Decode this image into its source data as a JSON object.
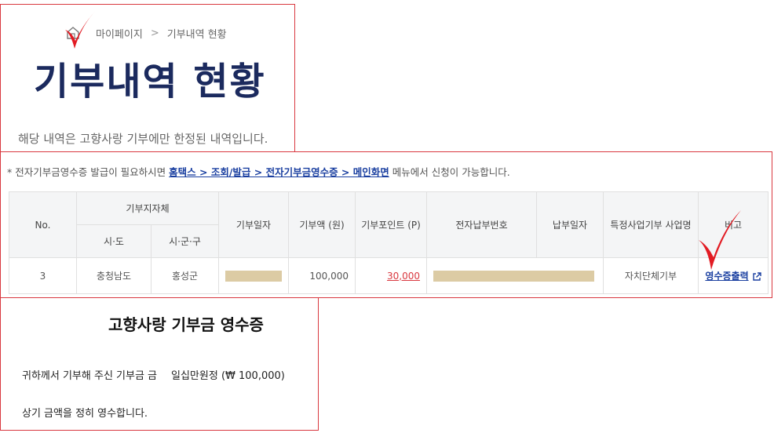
{
  "breadcrumb": {
    "home_icon": "home-icon",
    "items": [
      "마이페이지",
      "기부내역 현황"
    ],
    "separator": ">"
  },
  "page": {
    "title": "기부내역 현황",
    "description": "해당 내역은 고향사랑 기부에만 한정된 내역입니다."
  },
  "notice": {
    "prefix": "* 전자기부금영수증 발급이 필요하시면",
    "link": "홈택스 > 조회/발급 > 전자기부금영수증 > 메인화면",
    "suffix": "메뉴에서 신청이 가능합니다."
  },
  "table": {
    "headers": {
      "no": "No.",
      "region_group": "기부지자체",
      "sido": "시·도",
      "sigungu": "시·군·구",
      "date": "기부일자",
      "amount": "기부액 (원)",
      "points": "기부포인트 (P)",
      "payment_no": "전자납부번호",
      "payment_date": "납부일자",
      "business": "특정사업기부 사업명",
      "note": "비고"
    },
    "rows": [
      {
        "no": "3",
        "sido": "충청남도",
        "sigungu": "홍성군",
        "amount": "100,000",
        "points": "30,000",
        "business": "자치단체기부",
        "action": "영수증출력"
      }
    ]
  },
  "receipt": {
    "title": "고향사랑 기부금 영수증",
    "line1_prefix": "귀하께서 기부해 주신 기부금 금",
    "line1_amount": "일십만원정 (₩ 100,000)",
    "line2": "상기 금액을 정히 영수합니다."
  },
  "colors": {
    "accent_red": "#d9383f",
    "title_navy": "#1b2a5e",
    "link_blue": "#1a3fa0",
    "redaction": "#dccba4"
  }
}
